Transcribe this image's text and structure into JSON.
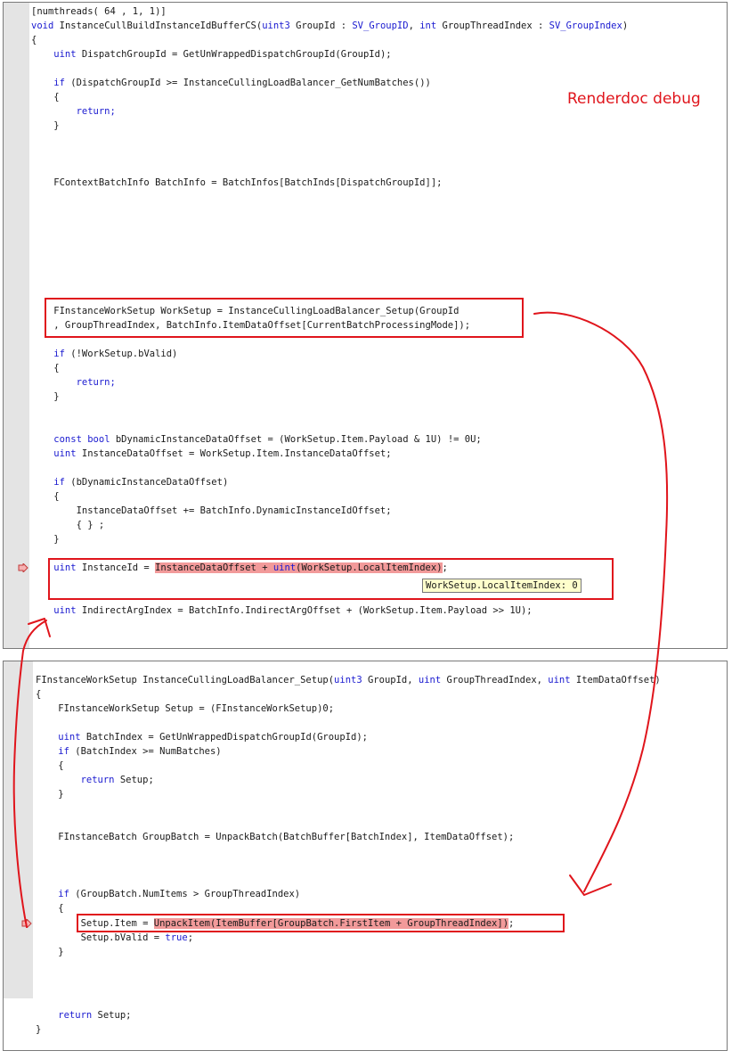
{
  "annotation": {
    "label": "Renderdoc debug",
    "color": "#e0151c"
  },
  "tooltip": {
    "text": "WorkSetup.LocalItemIndex: 0"
  },
  "pane1": {
    "l0": "[numthreads( 64 , 1, 1)]",
    "l1a": "void",
    "l1b": " InstanceCullBuildInstanceIdBufferCS(",
    "l1c": "uint3",
    "l1d": " GroupId : ",
    "l1e": "SV_GroupID",
    "l1f": ", ",
    "l1g": "int",
    "l1h": " GroupThreadIndex : ",
    "l1i": "SV_GroupIndex",
    "l1j": ")",
    "l2": "{",
    "l3a": "    uint",
    "l3b": " DispatchGroupId = GetUnWrappedDispatchGroupId(GroupId);",
    "l5a": "    if",
    "l5b": " (DispatchGroupId >= InstanceCullingLoadBalancer_GetNumBatches())",
    "l6": "    {",
    "l7": "        return;",
    "l8": "    }",
    "l12": "    FContextBatchInfo BatchInfo = BatchInfos[BatchInds[DispatchGroupId]];",
    "l21": "    FInstanceWorkSetup WorkSetup = InstanceCullingLoadBalancer_Setup(GroupId",
    "l22": "    , GroupThreadIndex, BatchInfo.ItemDataOffset[CurrentBatchProcessingMode]);",
    "l24a": "    if",
    "l24b": " (!WorkSetup.bValid)",
    "l25": "    {",
    "l26": "        return;",
    "l27": "    }",
    "l30a": "    const",
    "l30b": " ",
    "l30c": "bool",
    "l30d": " bDynamicInstanceDataOffset = (WorkSetup.Item.Payload & 1U) != 0U;",
    "l31a": "    uint",
    "l31b": " InstanceDataOffset = WorkSetup.Item.InstanceDataOffset;",
    "l33a": "    if",
    "l33b": " (bDynamicInstanceDataOffset)",
    "l34": "    {",
    "l35": "        InstanceDataOffset += BatchInfo.DynamicInstanceIdOffset;",
    "l36": "        { } ;",
    "l37": "    }",
    "l39a": "    uint",
    "l39b": " InstanceId = ",
    "l39c": "InstanceDataOffset + ",
    "l39d": "uint",
    "l39e": "(WorkSetup.LocalItemIndex)",
    "l39f": ";",
    "l42a": "    uint",
    "l42b": " IndirectArgIndex = BatchInfo.IndirectArgOffset + (WorkSetup.Item.Payload >> 1U);"
  },
  "pane2": {
    "l0a": "FInstanceWorkSetup InstanceCullingLoadBalancer_Setup(",
    "l0b": "uint3",
    "l0c": " GroupId, ",
    "l0d": "uint",
    "l0e": " GroupThreadIndex, ",
    "l0f": "uint",
    "l0g": " ItemDataOffset)",
    "l1": "{",
    "l2": "    FInstanceWorkSetup Setup = (FInstanceWorkSetup)0;",
    "l4a": "    uint",
    "l4b": " BatchIndex = GetUnWrappedDispatchGroupId(GroupId);",
    "l5a": "    if",
    "l5b": " (BatchIndex >= NumBatches)",
    "l6": "    {",
    "l7a": "        return",
    "l7b": " Setup;",
    "l8": "    }",
    "l11": "    FInstanceBatch GroupBatch = UnpackBatch(BatchBuffer[BatchIndex], ItemDataOffset);",
    "l15a": "    if",
    "l15b": " (GroupBatch.NumItems > GroupThreadIndex)",
    "l16": "    {",
    "l17a": "        Setup.Item = ",
    "l17b": "UnpackItem(ItemBuffer[GroupBatch.FirstItem + GroupThreadIndex])",
    "l17c": ";",
    "l18a": "        Setup.bValid = ",
    "l18b": "true",
    "l18c": ";",
    "l19": "    }",
    "l24a": "    return",
    "l24b": " Setup;",
    "l25": "}"
  }
}
